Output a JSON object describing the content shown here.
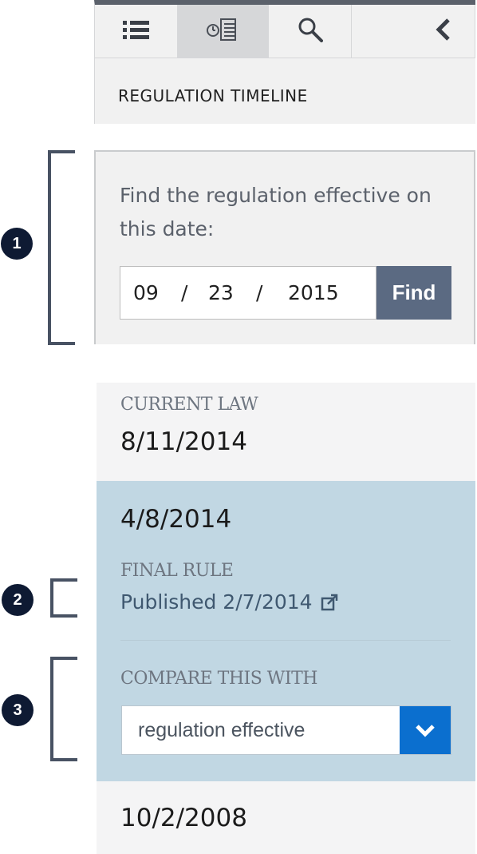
{
  "tabs": [
    {
      "icon": "list-icon",
      "active": false
    },
    {
      "icon": "timeline-icon",
      "active": true
    },
    {
      "icon": "search-icon",
      "active": false
    },
    {
      "icon": "chevron-left-icon",
      "active": false
    }
  ],
  "panel_title": "REGULATION TIMELINE",
  "find": {
    "prompt": "Find the regulation effective on this date:",
    "month": "09",
    "day": "23",
    "year": "2015",
    "separator": "/",
    "button_label": "Find"
  },
  "timeline": {
    "current_label": "CURRENT LAW",
    "current_date": "8/11/2014",
    "selected_date": "4/8/2014",
    "final_rule_label": "FINAL RULE",
    "published_text": "Published 2/7/2014",
    "compare_label": "COMPARE THIS WITH",
    "compare_value": "regulation effective",
    "older_date": "10/2/2008"
  },
  "callouts": [
    "1",
    "2",
    "3"
  ],
  "colors": {
    "tab_bar": "#f1f1f1",
    "find_button": "#5b6a82",
    "selected_entry": "#c1d7e3",
    "select_chevron": "#0b6fcf",
    "badge": "#0e1a33"
  }
}
